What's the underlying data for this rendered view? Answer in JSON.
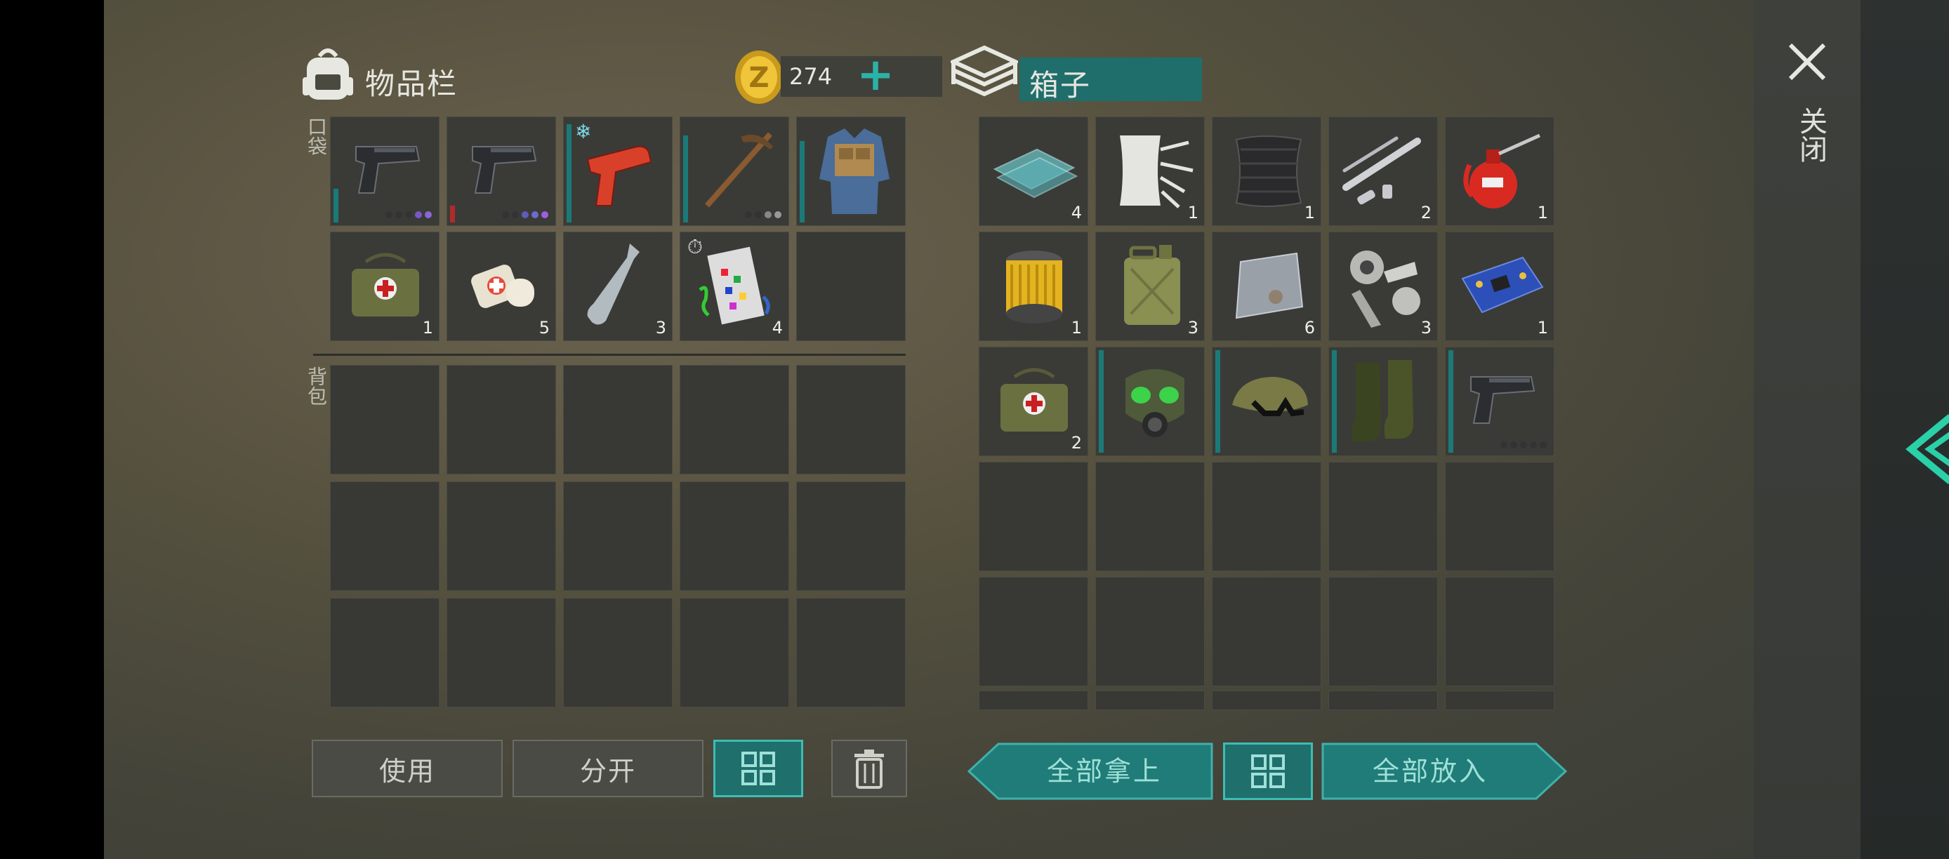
{
  "inventory": {
    "title": "物品栏",
    "coins": "274",
    "pocket_label": "口袋",
    "backpack_label": "背包",
    "pocket_items": [
      {
        "name": "pistol",
        "count": "",
        "durability": 0.3,
        "bar": "teal",
        "dots": [
          "#333",
          "#333",
          "#333",
          "#7a55c8",
          "#8a66d6"
        ]
      },
      {
        "name": "pistol",
        "count": "",
        "durability": 0.15,
        "bar": "red",
        "dots": [
          "#333",
          "#333",
          "#5d5db8",
          "#6b6bd0",
          "#9d5fe0"
        ]
      },
      {
        "name": "flare-gun",
        "count": "",
        "durability": 0.9,
        "bar": "teal",
        "dots": []
      },
      {
        "name": "pickaxe",
        "count": "",
        "durability": 0.8,
        "bar": "teal",
        "dots": [
          "#333",
          "#333",
          "#888",
          "#999"
        ]
      },
      {
        "name": "vest",
        "count": "",
        "durability": 0.75,
        "bar": "teal",
        "dots": []
      },
      {
        "name": "medkit",
        "count": "1"
      },
      {
        "name": "bandage",
        "count": "5"
      },
      {
        "name": "water-bottle",
        "count": "3"
      },
      {
        "name": "confetti",
        "count": "4",
        "timer": true
      }
    ],
    "buttons": {
      "use": "使用",
      "split": "分开"
    }
  },
  "box": {
    "title": "箱子",
    "items": [
      {
        "name": "glass",
        "count": "4"
      },
      {
        "name": "cloth",
        "count": "1"
      },
      {
        "name": "carbon-fabric",
        "count": "1"
      },
      {
        "name": "pipe-parts",
        "count": "2"
      },
      {
        "name": "oil-can",
        "count": "1"
      },
      {
        "name": "filter",
        "count": "1"
      },
      {
        "name": "jerrycan",
        "count": "3"
      },
      {
        "name": "metal-plate",
        "count": "6"
      },
      {
        "name": "mechanism",
        "count": "3"
      },
      {
        "name": "circuit-board",
        "count": "1"
      },
      {
        "name": "medkit",
        "count": "2"
      },
      {
        "name": "gas-mask",
        "count": "",
        "durability": 0.95
      },
      {
        "name": "cap",
        "count": "",
        "durability": 0.95
      },
      {
        "name": "boots",
        "count": "",
        "durability": 0.95
      },
      {
        "name": "pistol",
        "count": "",
        "durability": 0.95,
        "dots": [
          "#333",
          "#333",
          "#333",
          "#333",
          "#333"
        ]
      }
    ],
    "buttons": {
      "take_all": "全部拿上",
      "put_all": "全部放入"
    }
  },
  "close_label": "关闭",
  "colors": {
    "accent": "#1f7c78",
    "accent_border": "#3fb1aa",
    "gold": "#e0b22a"
  }
}
